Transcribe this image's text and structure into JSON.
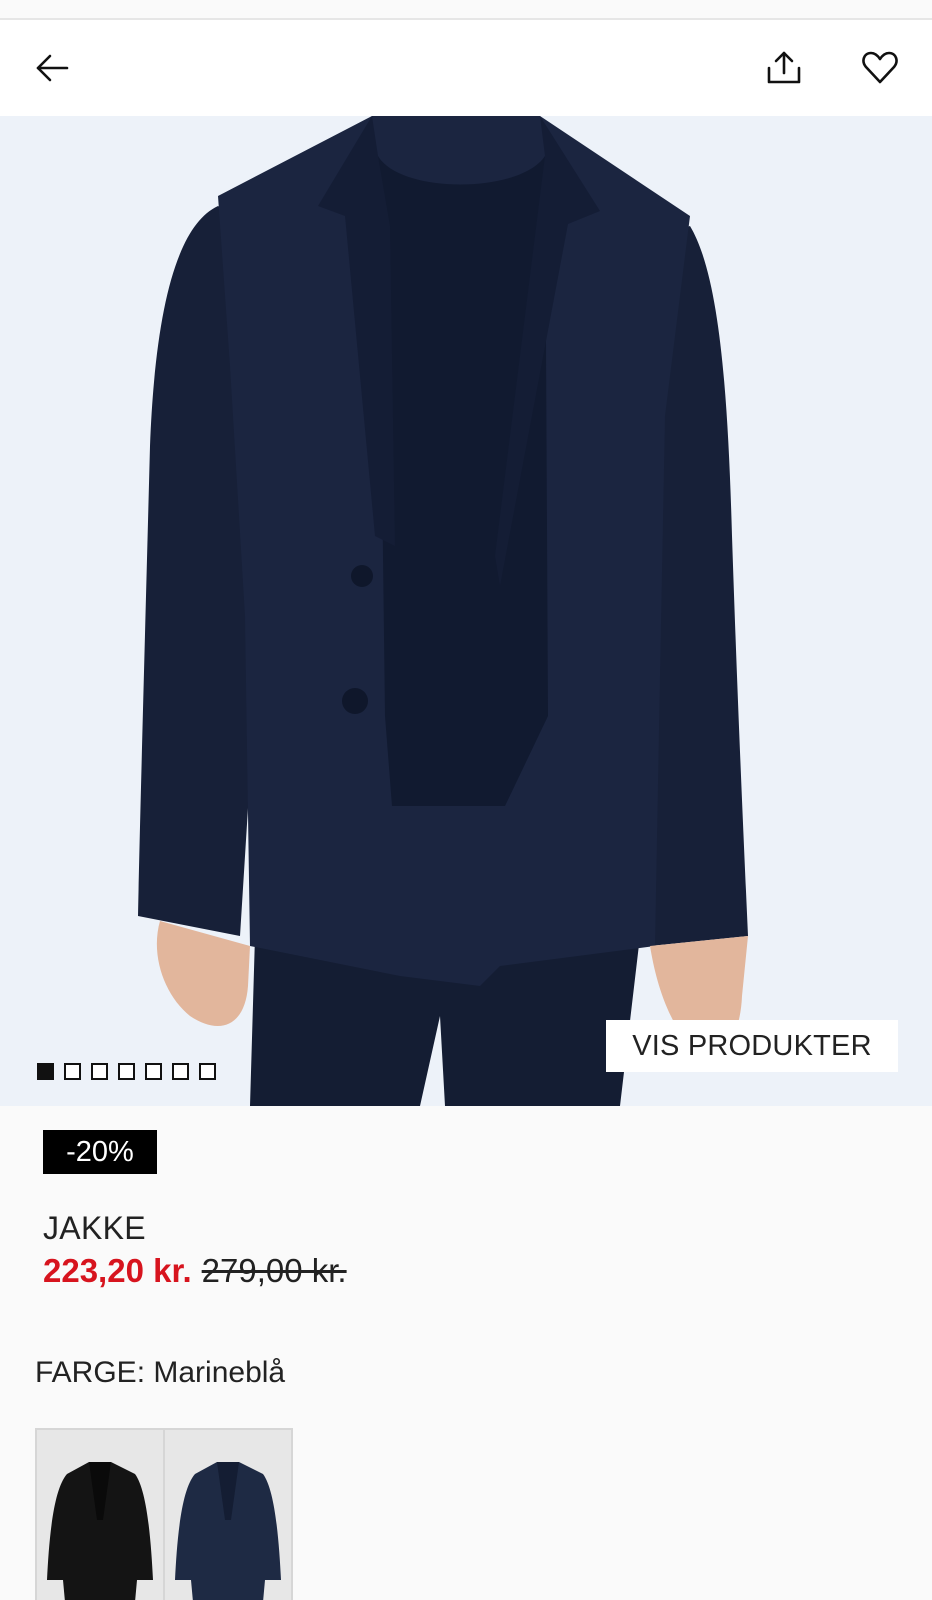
{
  "header": {
    "back_icon": "arrow-left-icon",
    "share_icon": "share-icon",
    "favorite_icon": "heart-icon"
  },
  "gallery": {
    "image_count": 7,
    "active_index": 0,
    "show_products_label": "VIS PRODUKTER"
  },
  "product": {
    "discount_badge": "-20%",
    "name": "JAKKE",
    "sale_price": "223,20 kr.",
    "original_price": "279,00 kr.",
    "sale_color": "#d7141e"
  },
  "color": {
    "label": "FARGE:",
    "selected": "Marineblå",
    "swatches": [
      {
        "color": "#141414"
      },
      {
        "color": "#1e2a44"
      }
    ]
  }
}
